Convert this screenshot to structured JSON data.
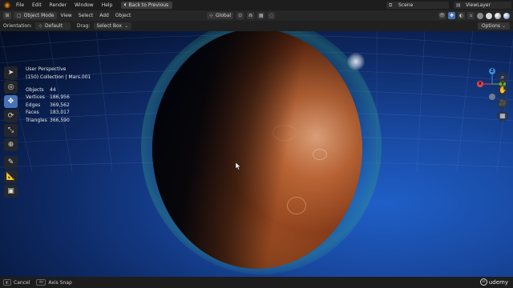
{
  "topbar": {
    "menus": [
      "File",
      "Edit",
      "Render",
      "Window",
      "Help"
    ],
    "back_button": "Back to Previous",
    "scene": "Scene",
    "view_layer": "ViewLayer"
  },
  "header": {
    "mode": "Object Mode",
    "menus": [
      "View",
      "Select",
      "Add",
      "Object"
    ],
    "transform_orientation": "Global"
  },
  "tool_settings": {
    "orientation_label": "Orientation:",
    "orientation_value": "Default",
    "drag_label": "Drag:",
    "drag_value": "Select Box",
    "options": "Options"
  },
  "overlay": {
    "view_name": "User Perspective",
    "collection": "(150) Collection | Mars.001",
    "stats": [
      {
        "key": "Objects",
        "value": "44"
      },
      {
        "key": "Vertices",
        "value": "186,956"
      },
      {
        "key": "Edges",
        "value": "369,562"
      },
      {
        "key": "Faces",
        "value": "183,017"
      },
      {
        "key": "Triangles",
        "value": "366,590"
      }
    ]
  },
  "toolbar": {
    "tools": [
      {
        "name": "select-tool",
        "glyph": "➤",
        "active": false
      },
      {
        "name": "cursor-tool",
        "glyph": "◎",
        "active": false
      },
      {
        "name": "move-tool",
        "glyph": "✥",
        "active": true
      },
      {
        "name": "rotate-tool",
        "glyph": "⟳",
        "active": false
      },
      {
        "name": "scale-tool",
        "glyph": "⤡",
        "active": false
      },
      {
        "name": "transform-tool",
        "glyph": "⊕",
        "active": false
      },
      {
        "name": "annotate-tool",
        "glyph": "✎",
        "active": false
      },
      {
        "name": "measure-tool",
        "glyph": "📐",
        "active": false
      },
      {
        "name": "add-cube-tool",
        "glyph": "▣",
        "active": false
      }
    ]
  },
  "gizmo": {
    "x_label": "X",
    "y_label": "Y",
    "z_label": "Z",
    "x_color": "#e8434f",
    "y_color": "#79b22b",
    "z_color": "#3d8ae0"
  },
  "statusbar": {
    "cancel": "Cancel",
    "axis_snap_key": "Alt",
    "axis_snap": "Axis Snap",
    "watermark": "udemy"
  },
  "colors": {
    "accent": "#4772b3",
    "blender_orange": "#e87d0d"
  }
}
